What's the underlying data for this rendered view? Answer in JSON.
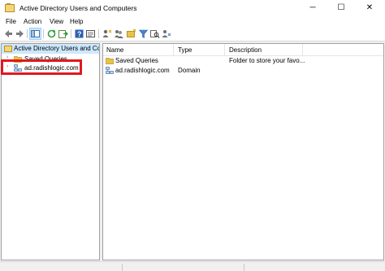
{
  "window": {
    "title": "Active Directory Users and Computers",
    "controls": {
      "minimize": "─",
      "maximize": "☐",
      "close": "✕"
    }
  },
  "menu": {
    "items": [
      "File",
      "Action",
      "View",
      "Help"
    ]
  },
  "toolbar": {
    "icons": [
      "back-arrow-icon",
      "forward-arrow-icon",
      "up-folder-icon",
      "show-tree-icon",
      "refresh-icon",
      "export-list-icon",
      "help-icon",
      "properties-icon",
      "new-user-icon",
      "new-group-icon",
      "new-ou-icon",
      "filter-icon",
      "find-icon",
      "add-to-group-icon"
    ]
  },
  "tree": {
    "root_label": "Active Directory Users and Com",
    "items": [
      {
        "label": "Saved Queries",
        "icon": "folder-icon"
      },
      {
        "label": "ad.radishlogic.com",
        "icon": "domain-icon"
      }
    ]
  },
  "list": {
    "columns": [
      "Name",
      "Type",
      "Description"
    ],
    "rows": [
      {
        "name": "Saved Queries",
        "type": "",
        "description": "Folder to store your favo...",
        "icon": "folder-icon"
      },
      {
        "name": "ad.radishlogic.com",
        "type": "Domain",
        "description": "",
        "icon": "domain-icon"
      }
    ]
  },
  "colors": {
    "highlight": "#e0191f",
    "selection": "#cce8ff",
    "folder": "#e8c24a"
  }
}
